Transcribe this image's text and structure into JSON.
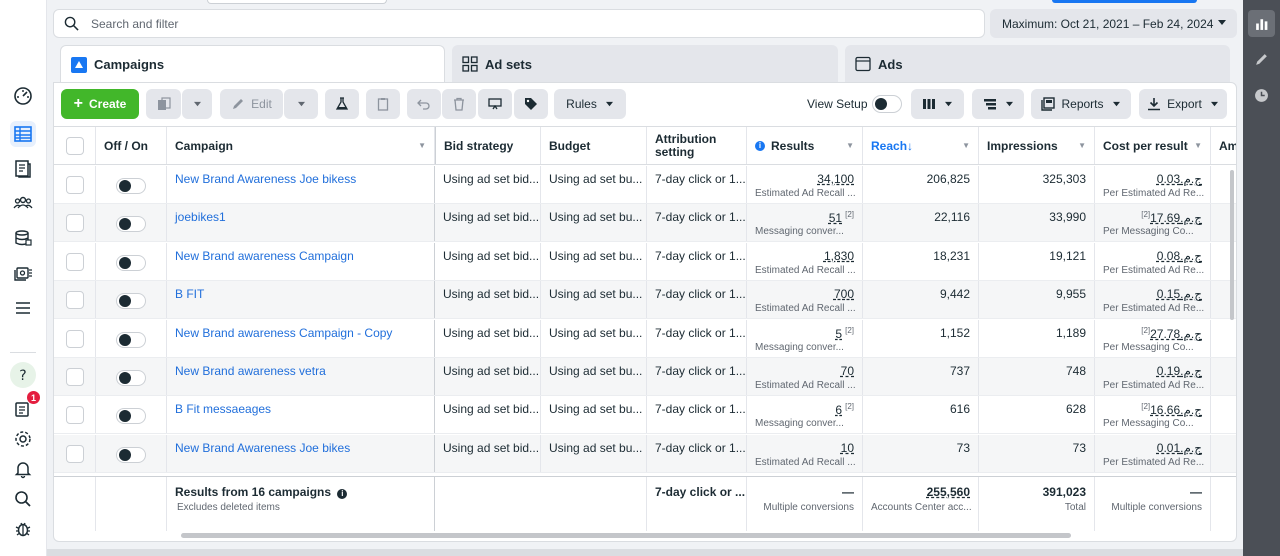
{
  "search": {
    "placeholder": "Search and filter"
  },
  "date_range": {
    "label": "Maximum: Oct 21, 2021 – Feb 24, 2024"
  },
  "tabs": [
    {
      "label": "Campaigns",
      "icon": "campaigns-icon",
      "active": true
    },
    {
      "label": "Ad sets",
      "icon": "ad-sets-icon",
      "active": false
    },
    {
      "label": "Ads",
      "icon": "ads-icon",
      "active": false
    }
  ],
  "toolbar": {
    "create_label": "Create",
    "edit_label": "Edit",
    "rules_label": "Rules",
    "view_setup_label": "View Setup",
    "reports_label": "Reports",
    "export_label": "Export"
  },
  "columns": {
    "off_on": "Off / On",
    "campaign": "Campaign",
    "bid_strategy": "Bid strategy",
    "budget": "Budget",
    "attribution": "Attribution setting",
    "results": "Results",
    "reach": "Reach",
    "reach_sort": "↓",
    "impressions": "Impressions",
    "cost_per_result": "Cost per result",
    "amount": "Am"
  },
  "rows": [
    {
      "name": "New Brand Awareness Joe bikess",
      "bid": "Using ad set bid...",
      "budget": "Using ad set bu...",
      "attribution": "7-day click or 1...",
      "results": "34,100",
      "results_sup": "",
      "results_sub": "Estimated Ad Recall ...",
      "reach": "206,825",
      "impressions": "325,303",
      "cpr": "ج.م.0.03",
      "cpr_sup": "",
      "cpr_sub": "Per Estimated Ad Re..."
    },
    {
      "name": "joebikes1",
      "bid": "Using ad set bid...",
      "budget": "Using ad set bu...",
      "attribution": "7-day click or 1...",
      "results": "51",
      "results_sup": "[2]",
      "results_sub": "Messaging conver...",
      "reach": "22,116",
      "impressions": "33,990",
      "cpr": "ج.م.17.69",
      "cpr_sup": "[2]",
      "cpr_sub": "Per Messaging Co..."
    },
    {
      "name": "New Brand awareness Campaign",
      "bid": "Using ad set bid...",
      "budget": "Using ad set bu...",
      "attribution": "7-day click or 1...",
      "results": "1,830",
      "results_sup": "",
      "results_sub": "Estimated Ad Recall ...",
      "reach": "18,231",
      "impressions": "19,121",
      "cpr": "ج.م.0.08",
      "cpr_sup": "",
      "cpr_sub": "Per Estimated Ad Re..."
    },
    {
      "name": "B FIT",
      "bid": "Using ad set bid...",
      "budget": "Using ad set bu...",
      "attribution": "7-day click or 1...",
      "results": "700",
      "results_sup": "",
      "results_sub": "Estimated Ad Recall ...",
      "reach": "9,442",
      "impressions": "9,955",
      "cpr": "ج.م.0.15",
      "cpr_sup": "",
      "cpr_sub": "Per Estimated Ad Re..."
    },
    {
      "name": "New Brand awareness Campaign - Copy",
      "bid": "Using ad set bid...",
      "budget": "Using ad set bu...",
      "attribution": "7-day click or 1...",
      "results": "5",
      "results_sup": "[2]",
      "results_sub": "Messaging conver...",
      "reach": "1,152",
      "impressions": "1,189",
      "cpr": "ج.م.27.78",
      "cpr_sup": "[2]",
      "cpr_sub": "Per Messaging Co..."
    },
    {
      "name": "New Brand awareness vetra",
      "bid": "Using ad set bid...",
      "budget": "Using ad set bu...",
      "attribution": "7-day click or 1...",
      "results": "70",
      "results_sup": "",
      "results_sub": "Estimated Ad Recall ...",
      "reach": "737",
      "impressions": "748",
      "cpr": "ج.م.0.19",
      "cpr_sup": "",
      "cpr_sub": "Per Estimated Ad Re..."
    },
    {
      "name": "B Fit messaeages",
      "bid": "Using ad set bid...",
      "budget": "Using ad set bu...",
      "attribution": "7-day click or 1...",
      "results": "6",
      "results_sup": "[2]",
      "results_sub": "Messaging conver...",
      "reach": "616",
      "impressions": "628",
      "cpr": "ج.م.16.66",
      "cpr_sup": "[2]",
      "cpr_sub": "Per Messaging Co..."
    },
    {
      "name": "New Brand Awareness Joe bikes",
      "bid": "Using ad set bid...",
      "budget": "Using ad set bu...",
      "attribution": "7-day click or 1...",
      "results": "10",
      "results_sup": "",
      "results_sub": "Estimated Ad Recall ...",
      "reach": "73",
      "impressions": "73",
      "cpr": "ج.م.0.01",
      "cpr_sup": "",
      "cpr_sub": "Per Estimated Ad Re..."
    }
  ],
  "totals": {
    "label": "Results from 16 campaigns",
    "sub": "Excludes deleted items",
    "attribution": "7-day click or ...",
    "results": "—",
    "results_sub": "Multiple conversions",
    "reach": "255,560",
    "reach_sub": "Accounts Center acc...",
    "impressions": "391,023",
    "impressions_sub": "Total",
    "cpr": "—",
    "cpr_sub": "Multiple conversions"
  },
  "nav": {
    "notification_count": "1",
    "items": [
      "dashboard-icon",
      "campaigns-table-icon",
      "pages-icon",
      "audiences-icon",
      "catalog-icon",
      "media-icon",
      "menu-icon",
      "help-icon",
      "notifications-icon",
      "settings-icon",
      "bell-icon",
      "search-icon",
      "bug-icon"
    ]
  },
  "colors": {
    "accent": "#1877f2",
    "create": "#42b72a",
    "link": "#216fdb",
    "rail": "#4b4f56"
  }
}
